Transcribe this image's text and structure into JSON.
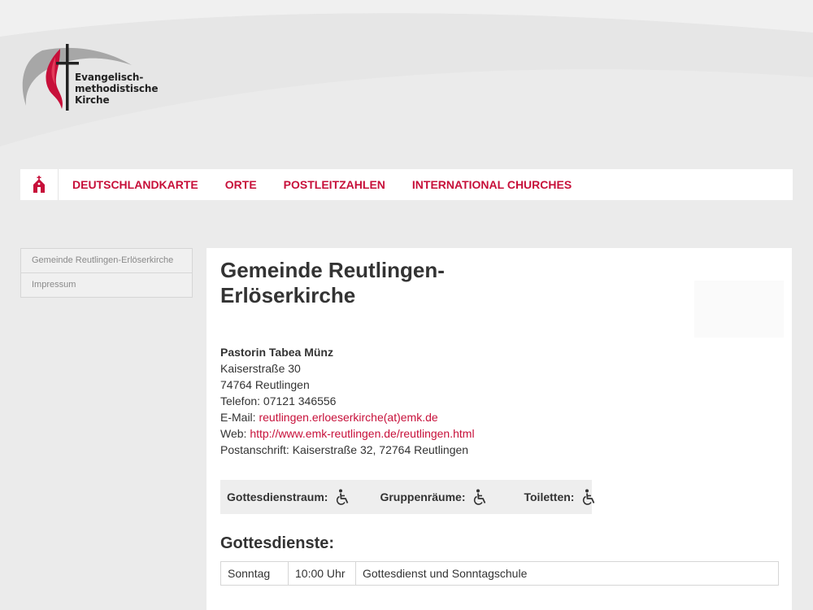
{
  "logo": {
    "lines": [
      "Evangelisch-",
      "methodistische",
      "Kirche"
    ]
  },
  "nav": {
    "home_icon": "church-icon",
    "items": [
      {
        "label": "DEUTSCHLANDKARTE"
      },
      {
        "label": "ORTE"
      },
      {
        "label": "POSTLEITZAHLEN"
      },
      {
        "label": "INTERNATIONAL CHURCHES"
      }
    ]
  },
  "sidebar": {
    "items": [
      {
        "label": "Gemeinde Reutlingen-Erlöserkirche"
      },
      {
        "label": "Impressum"
      }
    ]
  },
  "main": {
    "title_line1": "Gemeinde Reutlingen-",
    "title_line2": "Erlöserkirche",
    "contact": {
      "name": "Pastorin Tabea Münz",
      "street": "Kaiserstraße 30",
      "city": "74764 Reutlingen",
      "phone": "Telefon: 07121 346556",
      "email_label": "E-Mail: ",
      "email": "reutlingen.erloeserkirche(at)emk.de",
      "web_label": "Web: ",
      "web": "http://www.emk-reutlingen.de/reutlingen.html",
      "postal": "Postanschrift: Kaiserstraße 32, 72764 Reutlingen"
    },
    "accessibility": [
      {
        "label": "Gottesdienstraum:",
        "icon": "wheelchair-icon"
      },
      {
        "label": "Gruppenräume:",
        "icon": "wheelchair-icon"
      },
      {
        "label": "Toiletten:",
        "icon": "wheelchair-icon"
      }
    ],
    "services_heading": "Gottesdienste:",
    "services": [
      {
        "day": "Sonntag",
        "time": "10:00 Uhr",
        "desc": "Gottesdienst und Sonntagschule"
      }
    ]
  },
  "colors": {
    "accent": "#c7103a",
    "background": "#ebebeb",
    "panel": "#ffffff",
    "text": "#333333"
  }
}
